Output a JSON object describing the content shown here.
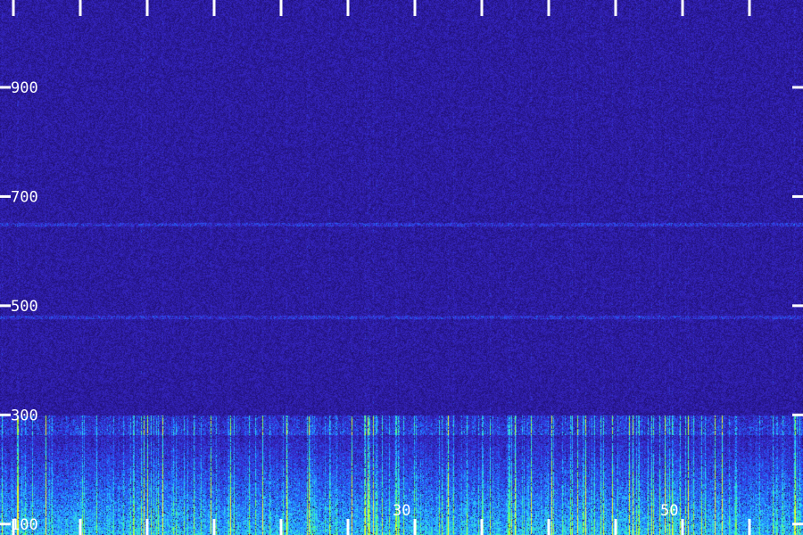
{
  "chart_data": {
    "type": "heatmap",
    "title": "",
    "xlabel": "",
    "ylabel": "",
    "y_ticks": [
      {
        "value": 100,
        "label": "100"
      },
      {
        "value": 300,
        "label": "300"
      },
      {
        "value": 500,
        "label": "500"
      },
      {
        "value": 700,
        "label": "700"
      },
      {
        "value": 900,
        "label": "900"
      }
    ],
    "x_ticks": [
      {
        "value": 30,
        "label": "30"
      },
      {
        "value": 50,
        "label": "50"
      }
    ],
    "x_minor_ticks": [
      1,
      6,
      11,
      16,
      21,
      26,
      31,
      36,
      41,
      46,
      51,
      56
    ],
    "xlim": [
      0,
      60
    ],
    "ylim": [
      80,
      1060
    ],
    "colormap": [
      "#1a0a5e",
      "#2a1a9a",
      "#3a2ad0",
      "#1e6cff",
      "#2fd0ff",
      "#3dff9a",
      "#b8ff2a",
      "#ffff33"
    ],
    "energy_bands": [
      {
        "from": 80,
        "to": 300,
        "level": "high"
      },
      {
        "from": 300,
        "to": 1060,
        "level": "low"
      }
    ],
    "harmonic_lines": [
      650,
      480
    ]
  }
}
